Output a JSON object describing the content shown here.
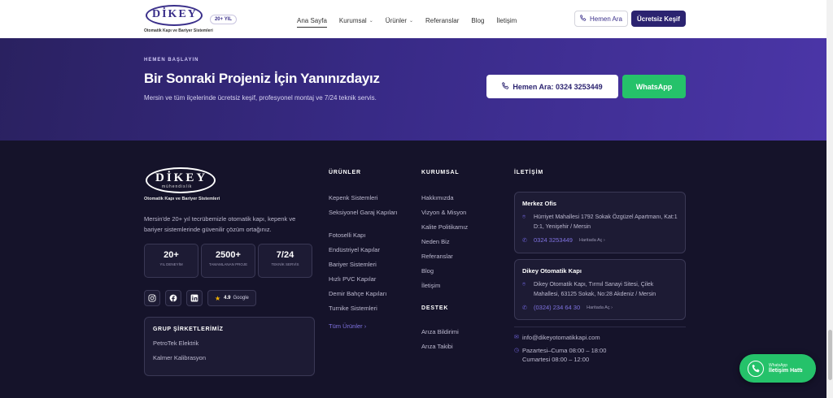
{
  "header": {
    "logo_text": "DİKEY",
    "logo_subtitle": "Otomatik Kapı ve Bariyer Sistemleri",
    "years_badge": "20+ YIL",
    "nav": [
      {
        "label": "Ana Sayfa",
        "active": true,
        "dropdown": false
      },
      {
        "label": "Kurumsal",
        "active": false,
        "dropdown": true
      },
      {
        "label": "Ürünler",
        "active": false,
        "dropdown": true
      },
      {
        "label": "Referanslar",
        "active": false,
        "dropdown": false
      },
      {
        "label": "Blog",
        "active": false,
        "dropdown": false
      },
      {
        "label": "İletişim",
        "active": false,
        "dropdown": false
      }
    ],
    "call_button": "Hemen Ara",
    "cta_button": "Ücretsiz Keşif"
  },
  "cta": {
    "eyebrow": "HEMEN BAŞLAYIN",
    "title": "Bir Sonraki Projeniz İçin Yanınızdayız",
    "description": "Mersin ve tüm ilçelerinde ücretsiz keşif, profesyonel montaj ve 7/24 teknik servis.",
    "call_button": "Hemen Ara: 0324 3253449",
    "whatsapp_button": "WhatsApp"
  },
  "footer": {
    "logo_text": "DİKEY",
    "logo_tagline": "mühendislik",
    "logo_subtitle": "Otomatik Kapı ve Bariyer Sistemleri",
    "about": "Mersin'de 20+ yıl tecrübemizle otomatik kapı, kepenk ve bariyer sistemlerinde güvenilir çözüm ortağınız.",
    "stats": [
      {
        "value": "20+",
        "label": "YIL DENEYİM"
      },
      {
        "value": "2500+",
        "label": "TAMAMLANAN PROJE"
      },
      {
        "value": "7/24",
        "label": "TEKNİK SERVİS"
      }
    ],
    "rating": {
      "value": "4.9",
      "source": "Google"
    },
    "group": {
      "title": "GRUP ŞİRKETLERİMİZ",
      "items": [
        "PetroTek Elektrik",
        "Kalmer Kalibrasyon"
      ]
    },
    "products": {
      "title": "ÜRÜNLER",
      "links": [
        "Kepenk Sistemleri",
        "Seksiyonel Garaj Kapıları",
        "Fotoselli Kapı",
        "Endüstriyel Kapılar",
        "Bariyer Sistemleri",
        "Hızlı PVC Kapılar",
        "Demir Bahçe Kapıları",
        "Turnike Sistemleri"
      ],
      "all_link": "Tüm Ürünler"
    },
    "corporate": {
      "title": "KURUMSAL",
      "links": [
        "Hakkımızda",
        "Vizyon & Misyon",
        "Kalite Politikamız",
        "Neden Biz",
        "Referanslar",
        "Blog",
        "İletişim"
      ]
    },
    "support": {
      "title": "DESTEK",
      "links": [
        "Arıza Bildirimi",
        "Arıza Takibi"
      ]
    },
    "contact": {
      "title": "İLETİŞİM",
      "offices": [
        {
          "name": "Merkez Ofis",
          "address": "Hürriyet Mahallesi 1792 Sokak Özgüzel Apartmanı, Kat:1 D:1, Yenişehir / Mersin",
          "phone": "0324 3253449",
          "map": "Haritada Aç"
        },
        {
          "name": "Dikey Otomatik Kapı",
          "address": "Dikey Otomatik Kapı, Tırmıl Sanayi Sitesi, Çilek Mahallesi, 63125 Sokak, No:28 Akdeniz / Mersin",
          "phone": "(0324) 234 64 30",
          "map": "Haritada Aç"
        }
      ],
      "email": "info@dikeyotomatikkapi.com",
      "hours_weekday": "Pazartesi–Cuma 08:00 – 18:00",
      "hours_saturday": "Cumartesi 08:00 – 12:00"
    }
  },
  "whatsapp_float": {
    "top": "WhatsApp",
    "bottom": "İletişim Hattı"
  },
  "colors": {
    "brand": "#2b2370",
    "accent": "#7f72e0",
    "whatsapp": "#25c26a",
    "footer_bg": "#15132a"
  }
}
